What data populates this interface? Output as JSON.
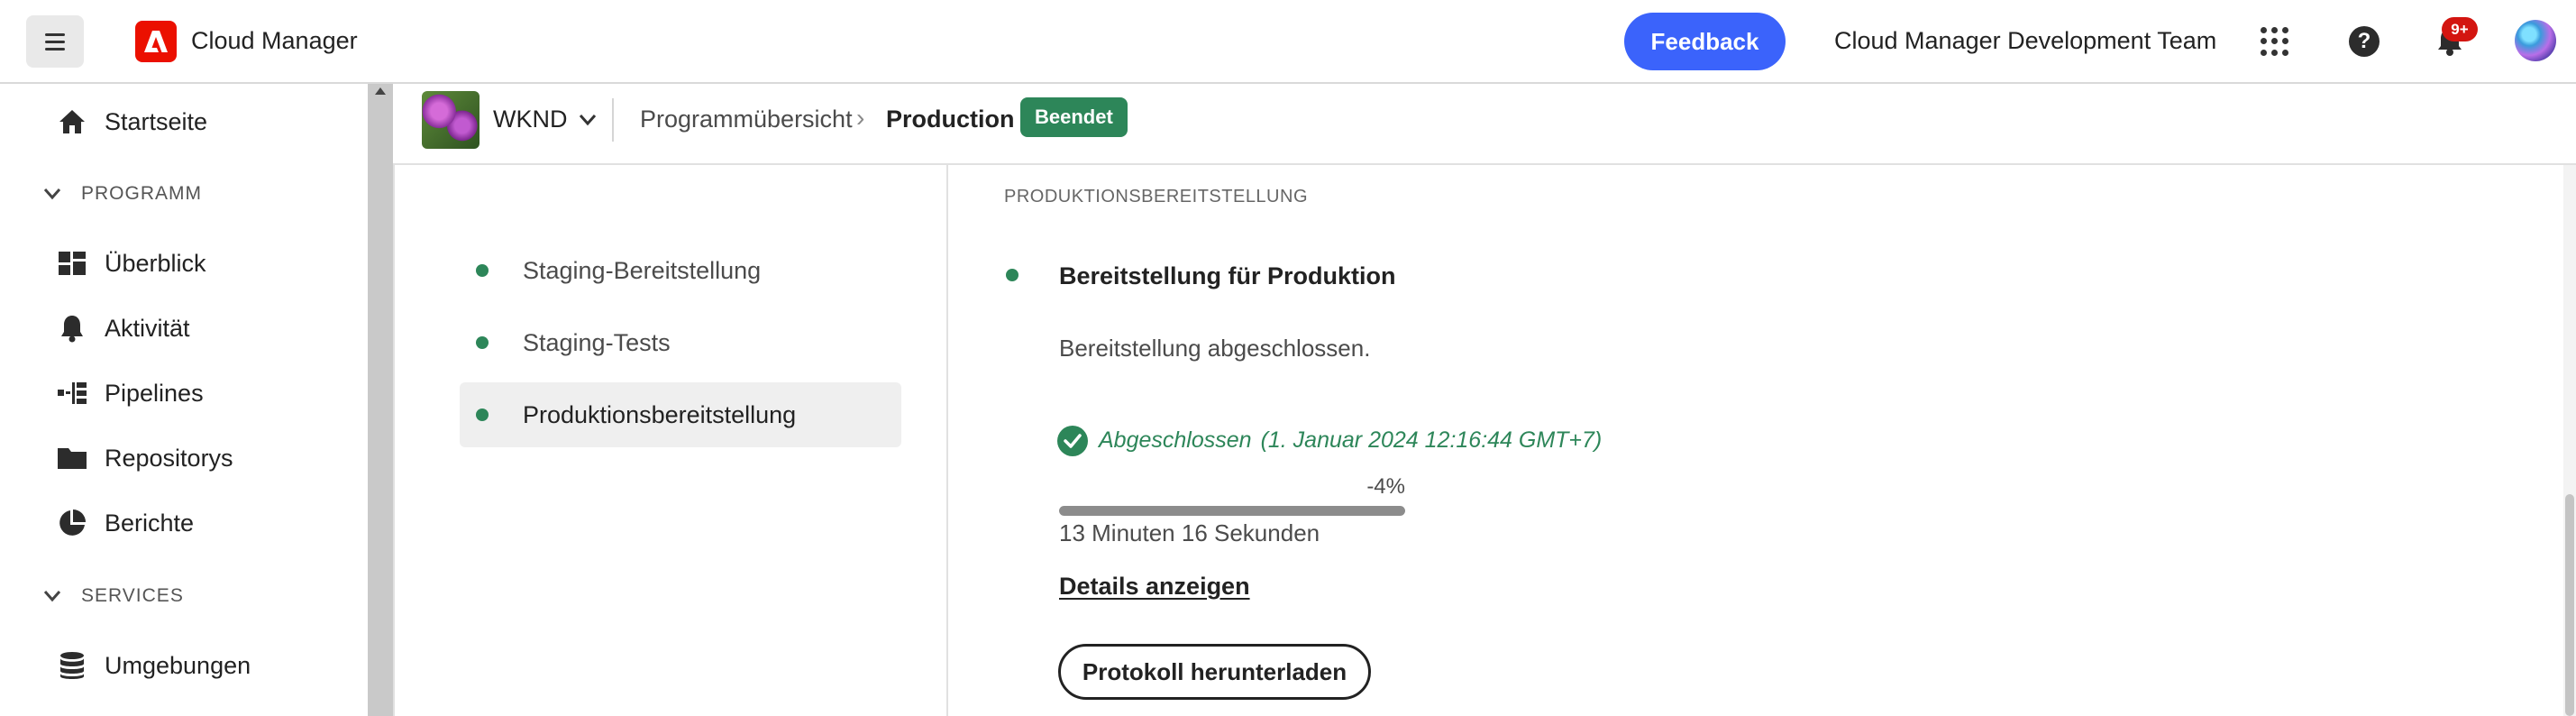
{
  "header": {
    "app_title": "Cloud Manager",
    "feedback_label": "Feedback",
    "org_name": "Cloud Manager Development Team",
    "notification_count": "9+",
    "brand_color": "#eb1000",
    "accent_color": "#3b63fb"
  },
  "sidebar": {
    "home": {
      "label": "Startseite",
      "icon": "home-icon"
    },
    "program_section": "PROGRAMM",
    "program_items": [
      {
        "label": "Überblick",
        "icon": "overview-icon"
      },
      {
        "label": "Aktivität",
        "icon": "bell-icon"
      },
      {
        "label": "Pipelines",
        "icon": "pipelines-icon"
      },
      {
        "label": "Repositorys",
        "icon": "folder-icon"
      },
      {
        "label": "Berichte",
        "icon": "reports-icon"
      }
    ],
    "services_section": "SERVICES",
    "services_items": [
      {
        "label": "Umgebungen",
        "icon": "database-icon"
      }
    ]
  },
  "breadcrumb": {
    "program": "WKND",
    "overview": "Programmübersicht",
    "separator": "›",
    "current": "Production",
    "status": "Beendet",
    "status_color": "#2d8659"
  },
  "pipeline": {
    "steps": [
      {
        "label": "Staging-Bereitstellung",
        "active": false
      },
      {
        "label": "Staging-Tests",
        "active": false
      },
      {
        "label": "Produktionsbereitstellung",
        "active": true
      }
    ],
    "section_title": "PRODUKTIONSBEREITSTELLUNG",
    "detail": {
      "title": "Bereitstellung für Produktion",
      "description": "Bereitstellung abgeschlossen.",
      "status": "Abgeschlossen",
      "timestamp": "(1. Januar 2024 12:16:44 GMT+7)",
      "progress_label": "-4%",
      "progress_fraction": 1.0,
      "duration": "13 Minuten 16 Sekunden",
      "details_link": "Details anzeigen",
      "download_button": "Protokoll herunterladen"
    }
  }
}
